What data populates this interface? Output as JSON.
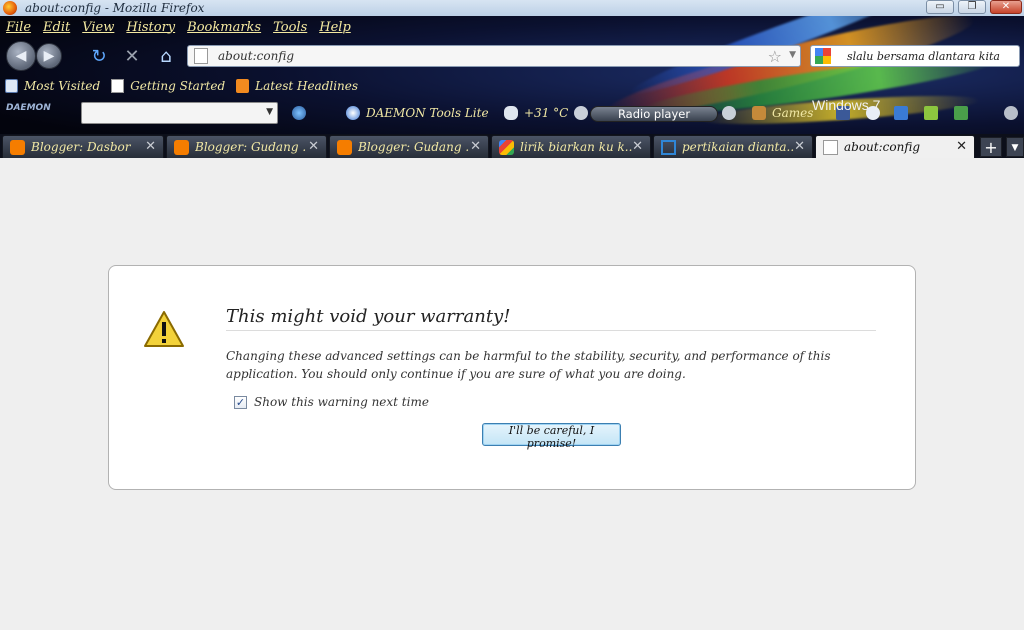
{
  "window": {
    "title": "about:config - Mozilla Firefox",
    "buttons": {
      "minimize": "▭",
      "maximize": "❐",
      "close": "✕"
    }
  },
  "menu": [
    "File",
    "Edit",
    "View",
    "History",
    "Bookmarks",
    "Tools",
    "Help"
  ],
  "navigation": {
    "url": "about:config",
    "search_value": "slalu bersama dlantara kita"
  },
  "bookmarks": [
    "Most Visited",
    "Getting Started",
    "Latest Headlines"
  ],
  "toolbar": {
    "daemon_logo": "DAEMON",
    "daemon_label": "DAEMON Tools Lite",
    "temperature": "+31 °C",
    "radio_label": "Radio player",
    "games_label": "Games",
    "windows_watermark": "Windows 7"
  },
  "tabs": [
    {
      "label": "Blogger: Dasbor",
      "icon": "blogger-icon"
    },
    {
      "label": "Blogger: Gudang ...",
      "icon": "blogger-icon"
    },
    {
      "label": "Blogger: Gudang ...",
      "icon": "blogger-icon"
    },
    {
      "label": "lirik biarkan ku k...",
      "icon": "google-icon"
    },
    {
      "label": "pertikaian dianta...",
      "icon": "page-icon"
    },
    {
      "label": "about:config",
      "icon": "blank-page-icon",
      "active": true
    }
  ],
  "warning": {
    "title": "This might void your warranty!",
    "text": "Changing these advanced settings can be harmful to the stability, security, and performance of this application. You should only continue if you are sure of what you are doing.",
    "checkbox_label": "Show this warning next time",
    "checkbox_checked": true,
    "button_label": "I'll be careful, I promise!"
  },
  "colors": {
    "menu_text": "#f1e8a5",
    "page_bg": "#efefef",
    "accent_button": "#3c7fb1"
  }
}
